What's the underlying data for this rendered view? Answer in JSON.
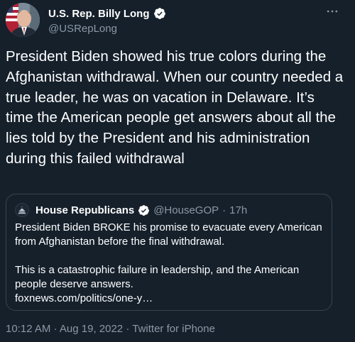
{
  "author": {
    "name": "U.S. Rep. Billy Long",
    "handle": "@USRepLong",
    "verified": true
  },
  "tweet": {
    "text": "President Biden showed his true colors during the Afghanistan withdrawal. When our country needed a true leader, he was on vacation in Delaware. It’s time the American people get answers about all the lies told by the President and his administration during this failed withdrawal"
  },
  "quote": {
    "author_name": "House Republicans",
    "author_handle": "@HouseGOP",
    "separator": "·",
    "time": "17h",
    "verified": true,
    "paragraph1": "President Biden BROKE his promise to evacuate every American from Afghanistan before the final withdrawal.",
    "paragraph2": "This is a catastrophic failure in leadership, and the American people deserve answers.",
    "link": "foxnews.com/politics/one-y…"
  },
  "meta": {
    "time": "10:12 AM",
    "separator1": "·",
    "date": "Aug 19, 2022",
    "separator2": "·",
    "source": "Twitter for iPhone"
  },
  "icons": {
    "more": "more-horizontal-icon",
    "verified": "verified-badge-icon"
  },
  "colors": {
    "background": "#15202b",
    "text_primary": "#ffffff",
    "text_secondary": "#8b98a5",
    "border": "#38444d",
    "verified_badge": "#ffffff"
  }
}
